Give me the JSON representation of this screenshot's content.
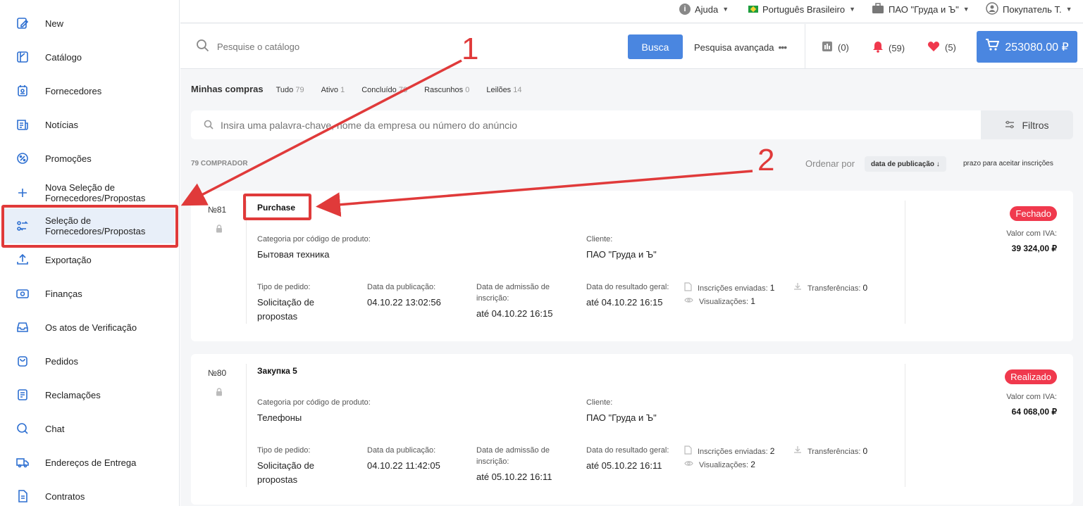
{
  "sidebar": {
    "items": [
      {
        "label": "New",
        "icon": "new-icon"
      },
      {
        "label": "Catálogo",
        "icon": "catalog-icon"
      },
      {
        "label": "Fornecedores",
        "icon": "suppliers-icon"
      },
      {
        "label": "Notícias",
        "icon": "news-icon"
      },
      {
        "label": "Promoções",
        "icon": "percent-icon"
      },
      {
        "label": "Nova Seleção de Fornecedores/Propostas",
        "icon": "plus-icon"
      },
      {
        "label": "Seleção de Fornecedores/Propostas",
        "icon": "swap-icon"
      },
      {
        "label": "Exportação",
        "icon": "upload-icon"
      },
      {
        "label": "Finanças",
        "icon": "money-icon"
      },
      {
        "label": "Os atos de Verificação",
        "icon": "inbox-icon"
      },
      {
        "label": "Pedidos",
        "icon": "bag-icon"
      },
      {
        "label": "Reclamações",
        "icon": "complaint-icon"
      },
      {
        "label": "Chat",
        "icon": "chat-icon"
      },
      {
        "label": "Endereços de Entrega",
        "icon": "truck-icon"
      },
      {
        "label": "Contratos",
        "icon": "document-icon"
      }
    ]
  },
  "topbar": {
    "help": "Ajuda",
    "language": "Português Brasileiro",
    "company": "ПАО \"Груда и Ъ\"",
    "user": "Покупатель Т."
  },
  "search": {
    "placeholder": "Pesquise o catálogo",
    "button": "Busca",
    "advanced": "Pesquisa avançada",
    "compare_count": "(0)",
    "notifications_count": "(59)",
    "favorites_count": "(5)",
    "cart_total": "253080.00 ₽"
  },
  "purchases": {
    "title": "Minhas compras",
    "tabs": [
      {
        "label": "Tudo",
        "count": "79"
      },
      {
        "label": "Ativo",
        "count": "1"
      },
      {
        "label": "Concluído",
        "count": "78"
      },
      {
        "label": "Rascunhos",
        "count": "0"
      },
      {
        "label": "Leilões",
        "count": "14"
      }
    ],
    "filter_placeholder": "Insira uma palavra-chave, nome da empresa ou número do anúncio",
    "filters_button": "Filtros",
    "total": "79 COMPRADOR",
    "sort_label": "Ordenar por",
    "sort_active": "data de publicação ↓",
    "sort_other": "prazo para aceitar inscrições"
  },
  "cards": [
    {
      "number": "№81",
      "title": "Purchase",
      "category_label": "Categoria por código de produto:",
      "category": "Бытовая техника",
      "client_label": "Cliente:",
      "client": "ПАО \"Груда и Ъ\"",
      "order_type_label": "Tipo de pedido:",
      "order_type": "Solicitação de propostas",
      "pub_date_label": "Data da publicação:",
      "pub_date": "04.10.22 13:02:56",
      "admission_label": "Data de admissão de inscrição:",
      "admission": "até 04.10.22 16:15",
      "result_label": "Data do resultado geral:",
      "result": "até 04.10.22 16:15",
      "sent_label": "Inscrições enviadas:",
      "sent": "1",
      "views_label": "Visualizações:",
      "views": "1",
      "transfers_label": "Transferências:",
      "transfers": "0",
      "status": "Fechado",
      "value_label": "Valor com IVA:",
      "value": "39 324,00 ₽"
    },
    {
      "number": "№80",
      "title": "Закупка 5",
      "category_label": "Categoria por código de produto:",
      "category": "Телефоны",
      "client_label": "Cliente:",
      "client": "ПАО \"Груда и Ъ\"",
      "order_type_label": "Tipo de pedido:",
      "order_type": "Solicitação de propostas",
      "pub_date_label": "Data da publicação:",
      "pub_date": "04.10.22 11:42:05",
      "admission_label": "Data de admissão de inscrição:",
      "admission": "até 05.10.22 16:11",
      "result_label": "Data do resultado geral:",
      "result": "até 05.10.22 16:11",
      "sent_label": "Inscrições enviadas:",
      "sent": "2",
      "views_label": "Visualizações:",
      "views": "2",
      "transfers_label": "Transferências:",
      "transfers": "0",
      "status": "Realizado",
      "value_label": "Valor com IVA:",
      "value": "64 068,00 ₽"
    }
  ],
  "annotations": {
    "one": "1",
    "two": "2"
  },
  "colors": {
    "accent": "#4a86e0",
    "annotation": "#e03a3a",
    "badge": "#f0394d"
  }
}
